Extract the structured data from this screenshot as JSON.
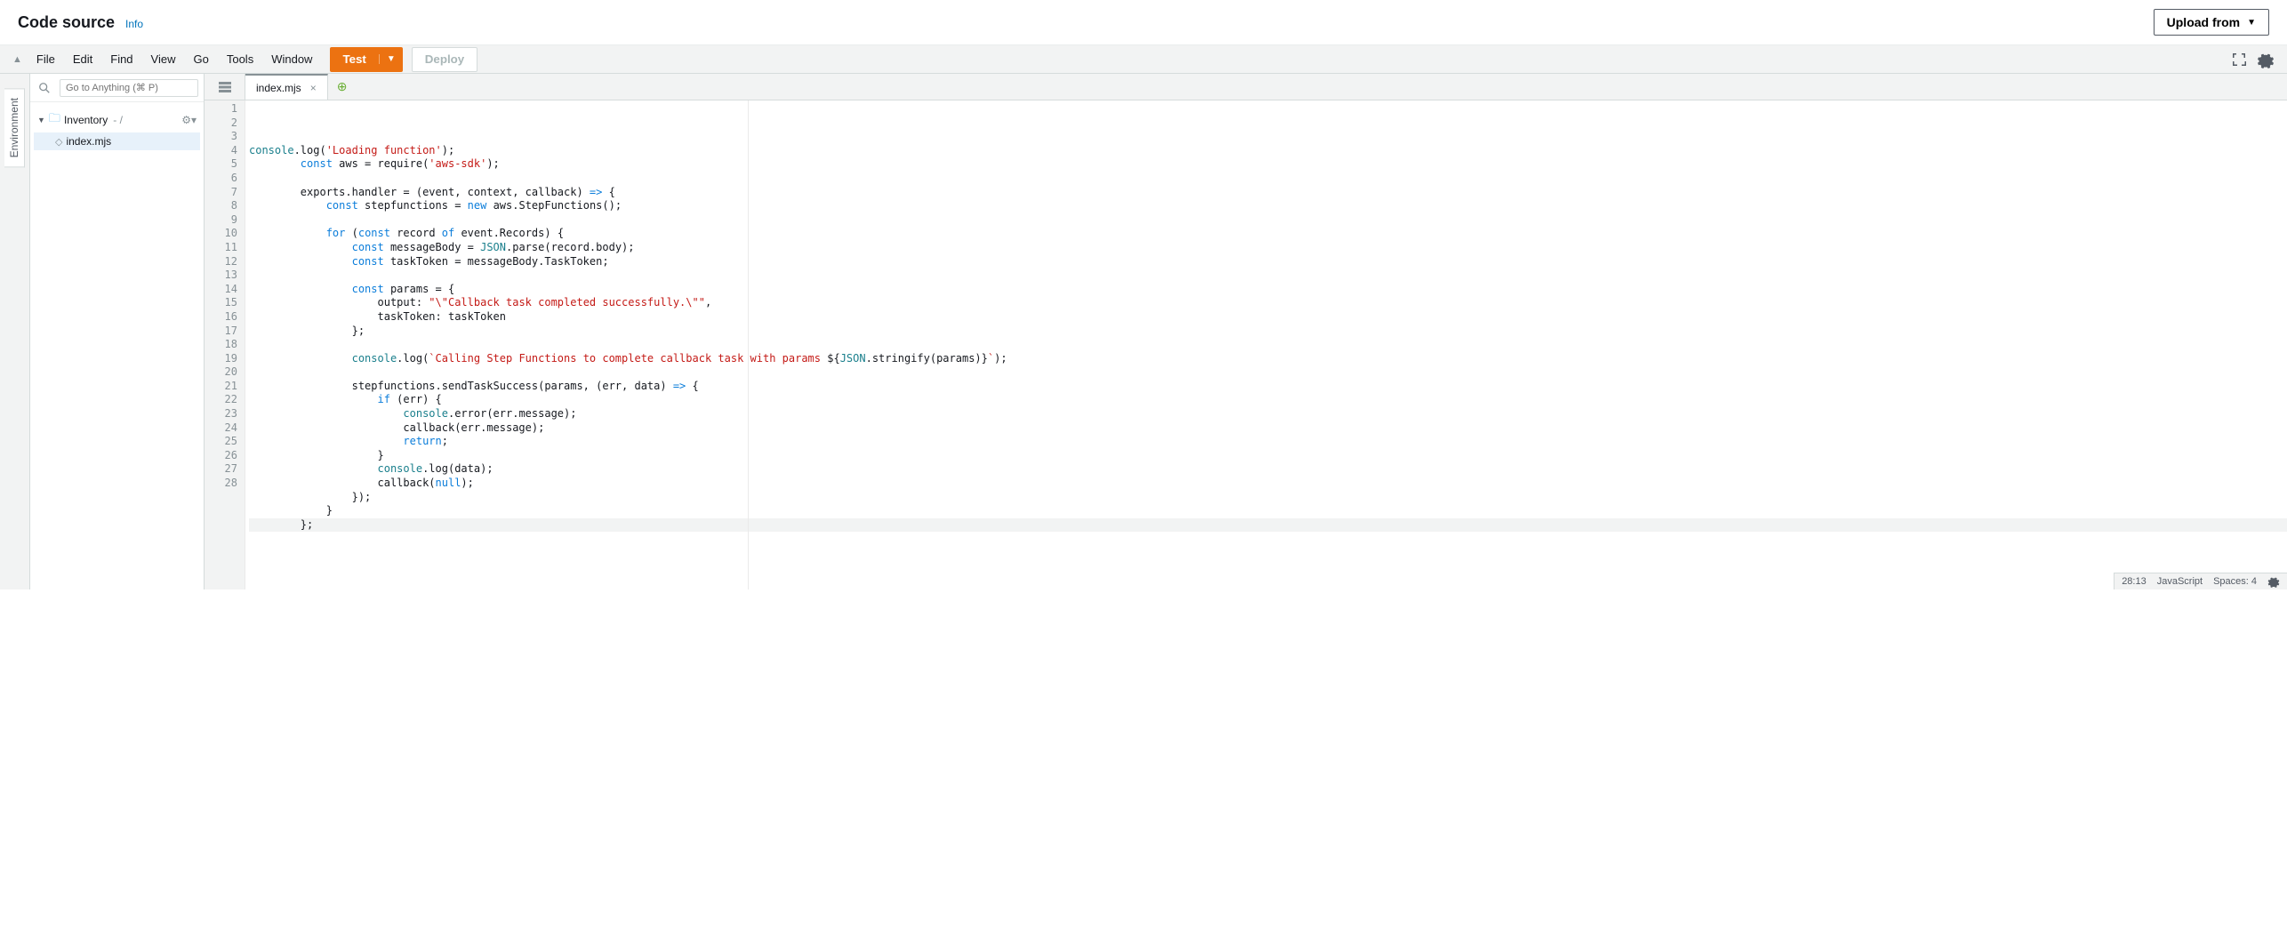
{
  "header": {
    "title": "Code source",
    "info": "Info",
    "upload": "Upload from"
  },
  "menu": {
    "file": "File",
    "edit": "Edit",
    "find": "Find",
    "view": "View",
    "go": "Go",
    "tools": "Tools",
    "window": "Window",
    "test": "Test",
    "deploy": "Deploy"
  },
  "sidebar": {
    "vtab": "Environment",
    "search_placeholder": "Go to Anything (⌘ P)",
    "root": "Inventory",
    "file": "index.mjs"
  },
  "tabs": {
    "active": "index.mjs"
  },
  "status": {
    "pos": "28:13",
    "lang": "JavaScript",
    "spaces": "Spaces: 4"
  },
  "code": [
    [
      [
        "id",
        "console"
      ],
      [
        "",
        ".log("
      ],
      [
        "str",
        "'Loading function'"
      ],
      [
        "",
        ");"
      ]
    ],
    [
      [
        "",
        "        "
      ],
      [
        "kw",
        "const"
      ],
      [
        "",
        " aws = require("
      ],
      [
        "str",
        "'aws-sdk'"
      ],
      [
        "",
        ");"
      ]
    ],
    [
      [
        "",
        ""
      ]
    ],
    [
      [
        "",
        "        exports.handler = (event, context, callback) "
      ],
      [
        "op",
        "=>"
      ],
      [
        "",
        " {"
      ]
    ],
    [
      [
        "",
        "            "
      ],
      [
        "kw",
        "const"
      ],
      [
        "",
        " stepfunctions = "
      ],
      [
        "kw",
        "new"
      ],
      [
        "",
        " aws.StepFunctions();"
      ]
    ],
    [
      [
        "",
        ""
      ]
    ],
    [
      [
        "",
        "            "
      ],
      [
        "kw",
        "for"
      ],
      [
        "",
        " ("
      ],
      [
        "kw",
        "const"
      ],
      [
        "",
        " record "
      ],
      [
        "kw",
        "of"
      ],
      [
        "",
        " event.Records) {"
      ]
    ],
    [
      [
        "",
        "                "
      ],
      [
        "kw",
        "const"
      ],
      [
        "",
        " messageBody = "
      ],
      [
        "id",
        "JSON"
      ],
      [
        "",
        ".parse(record.body);"
      ]
    ],
    [
      [
        "",
        "                "
      ],
      [
        "kw",
        "const"
      ],
      [
        "",
        " taskToken = messageBody.TaskToken;"
      ]
    ],
    [
      [
        "",
        ""
      ]
    ],
    [
      [
        "",
        "                "
      ],
      [
        "kw",
        "const"
      ],
      [
        "",
        " params = {"
      ]
    ],
    [
      [
        "",
        "                    output: "
      ],
      [
        "str",
        "\"\\\"Callback task completed successfully.\\\"\""
      ],
      [
        "",
        ","
      ]
    ],
    [
      [
        "",
        "                    taskToken: taskToken"
      ]
    ],
    [
      [
        "",
        "                };"
      ]
    ],
    [
      [
        "",
        ""
      ]
    ],
    [
      [
        "",
        "                "
      ],
      [
        "id",
        "console"
      ],
      [
        "",
        ".log("
      ],
      [
        "str",
        "`Calling Step Functions to complete callback task with params "
      ],
      [
        "",
        "${"
      ],
      [
        "id",
        "JSON"
      ],
      [
        "",
        ".stringify(params)}"
      ],
      [
        "str",
        "`"
      ],
      [
        "",
        ");"
      ]
    ],
    [
      [
        "",
        ""
      ]
    ],
    [
      [
        "",
        "                stepfunctions.sendTaskSuccess(params, (err, data) "
      ],
      [
        "op",
        "=>"
      ],
      [
        "",
        " {"
      ]
    ],
    [
      [
        "",
        "                    "
      ],
      [
        "kw",
        "if"
      ],
      [
        "",
        " (err) {"
      ]
    ],
    [
      [
        "",
        "                        "
      ],
      [
        "id",
        "console"
      ],
      [
        "",
        ".error(err.message);"
      ]
    ],
    [
      [
        "",
        "                        callback(err.message);"
      ]
    ],
    [
      [
        "",
        "                        "
      ],
      [
        "kw",
        "return"
      ],
      [
        "",
        ";"
      ]
    ],
    [
      [
        "",
        "                    }"
      ]
    ],
    [
      [
        "",
        "                    "
      ],
      [
        "id",
        "console"
      ],
      [
        "",
        ".log(data);"
      ]
    ],
    [
      [
        "",
        "                    callback("
      ],
      [
        "kw",
        "null"
      ],
      [
        "",
        ");"
      ]
    ],
    [
      [
        "",
        "                });"
      ]
    ],
    [
      [
        "",
        "            }"
      ]
    ],
    [
      [
        "",
        "        };"
      ]
    ]
  ]
}
